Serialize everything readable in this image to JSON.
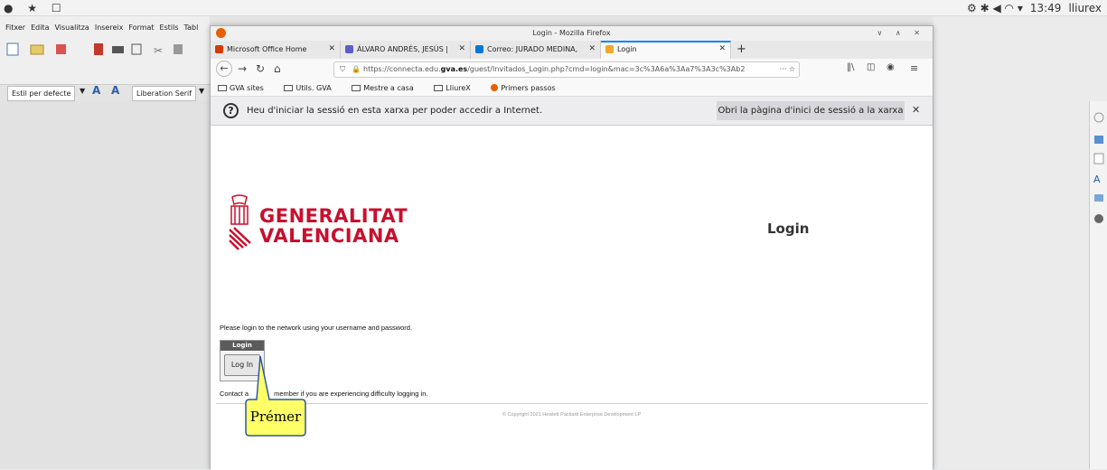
{
  "system_bar": {
    "time": "13:49",
    "user": "lliurex"
  },
  "libreoffice": {
    "menus": [
      "Fitxer",
      "Edita",
      "Visualitza",
      "Insereix",
      "Format",
      "Estils",
      "Tabl"
    ],
    "paragraph_style": "Estil per defecte",
    "font_name": "Liberation Serif"
  },
  "firefox": {
    "window_title": "Login - Mozilla Firefox",
    "tabs": [
      {
        "label": "Microsoft Office Home",
        "color": "#d83b01"
      },
      {
        "label": "ÁLVARO ANDRÉS, JESÚS |",
        "color": "#5b5fc7"
      },
      {
        "label": "Correo: JURADO MEDINA,",
        "color": "#0078d4"
      },
      {
        "label": "Login",
        "color": "#f4a62a",
        "active": true
      }
    ],
    "url_prefix": "https://connecta.edu.",
    "url_domain": "gva.es",
    "url_suffix": "/guest/Invitados_Login.php?cmd=login&mac=3c%3A6a%3Aa7%3A3c%3Ab2",
    "url_more": "···",
    "bookmarks": [
      "GVA sites",
      "Utils. GVA",
      "Mestre a casa",
      "LliureX",
      "Primers passos"
    ],
    "notice": {
      "message": "Heu d'iniciar la sessió en esta xarxa per poder accedir a Internet.",
      "button": "Obri la pàgina d'inici de sessió a la xarxa"
    }
  },
  "page": {
    "logo_line1": "GENERALITAT",
    "logo_line2": "VALENCIANA",
    "title": "Login",
    "instructions": "Please login to the network using your username and password.",
    "login_header": "Login",
    "login_button": "Log In",
    "contact_start": "Contact a",
    "contact_end": "member if you are experiencing difficulty logging in.",
    "copyright": "© Copyright 2021 Hewlett Packard Enterprise Development LP"
  },
  "callout": {
    "text": "Prémer"
  }
}
